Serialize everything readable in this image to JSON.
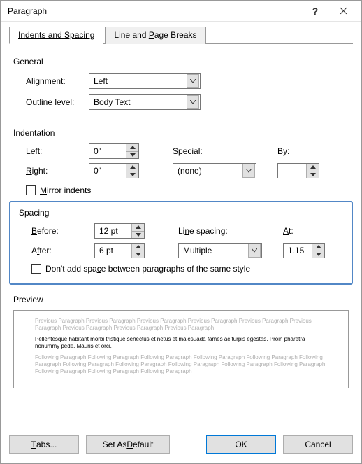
{
  "window": {
    "title": "Paragraph"
  },
  "tabs": {
    "indents": "Indents and Spacing",
    "breaks_pre": "Line and ",
    "breaks_u": "P",
    "breaks_post": "age Breaks"
  },
  "general": {
    "label": "General",
    "alignment_pre": "Ali",
    "alignment_u": "g",
    "alignment_post": "nment:",
    "alignment_value": "Left",
    "outline_u": "O",
    "outline_post": "utline level:",
    "outline_value": "Body Text"
  },
  "indentation": {
    "label": "Indentation",
    "left_u": "L",
    "left_post": "eft:",
    "left_value": "0\"",
    "right_u": "R",
    "right_post": "ight:",
    "right_value": "0\"",
    "special_u": "S",
    "special_post": "pecial:",
    "special_value": "(none)",
    "by_pre": "B",
    "by_u": "y",
    "by_post": ":",
    "by_value": "",
    "mirror_u": "M",
    "mirror_post": "irror indents"
  },
  "spacing": {
    "label": "Spacing",
    "before_u": "B",
    "before_post": "efore:",
    "before_value": "12 pt",
    "after_pre": "A",
    "after_u": "f",
    "after_post": "ter:",
    "after_value": "6 pt",
    "linespacing_pre": "Li",
    "linespacing_u": "n",
    "linespacing_post": "e spacing:",
    "linespacing_value": "Multiple",
    "at_u": "A",
    "at_post": "t:",
    "at_value": "1.15",
    "dontadd_pre": "Don't add spa",
    "dontadd_u": "c",
    "dontadd_post": "e between paragraphs of the same style"
  },
  "preview": {
    "label": "Preview",
    "prev": "Previous Paragraph Previous Paragraph Previous Paragraph Previous Paragraph Previous Paragraph Previous Paragraph Previous Paragraph Previous Paragraph Previous Paragraph",
    "sample": "Pellentesque habitant morbi tristique senectus et netus et malesuada fames ac turpis egestas. Proin pharetra nonummy pede. Mauris et orci.",
    "next": "Following Paragraph Following Paragraph Following Paragraph Following Paragraph Following Paragraph Following Paragraph Following Paragraph Following Paragraph Following Paragraph Following Paragraph Following Paragraph Following Paragraph Following Paragraph Following Paragraph"
  },
  "buttons": {
    "tabs_u": "T",
    "tabs_post": "abs...",
    "default_pre": "Set As ",
    "default_u": "D",
    "default_post": "efault",
    "ok": "OK",
    "cancel": "Cancel"
  }
}
